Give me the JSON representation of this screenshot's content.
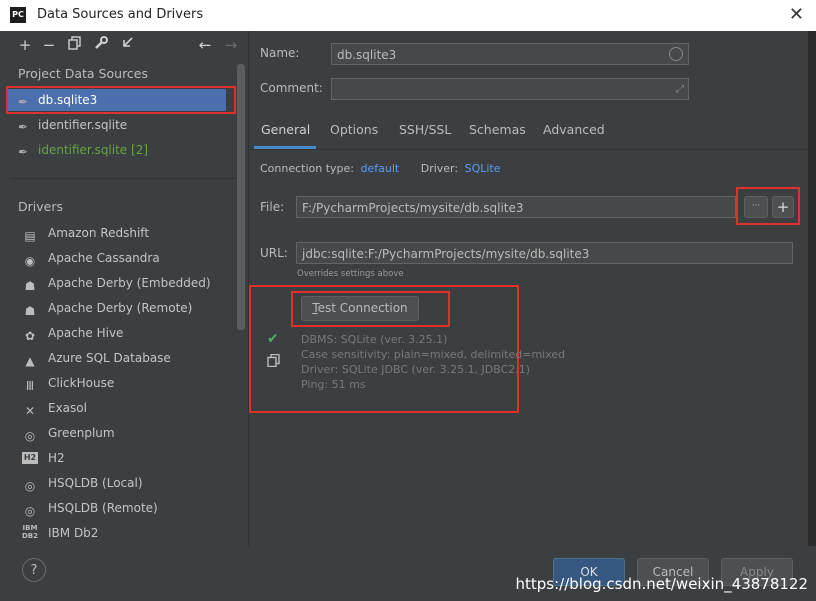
{
  "window": {
    "title": "Data Sources and Drivers",
    "app_icon": "PC"
  },
  "toolbar": {
    "items": [
      "+",
      "−",
      "copy-icon",
      "wrench-icon",
      "import-icon",
      "←",
      "→"
    ]
  },
  "left": {
    "project_header": "Project Data Sources",
    "sources": [
      {
        "label": "db.sqlite3",
        "state": "selected"
      },
      {
        "label": "identifier.sqlite",
        "state": "normal"
      },
      {
        "label": "identifier.sqlite [2]",
        "state": "green"
      }
    ],
    "drivers_header": "Drivers",
    "drivers": [
      "Amazon Redshift",
      "Apache Cassandra",
      "Apache Derby (Embedded)",
      "Apache Derby (Remote)",
      "Apache Hive",
      "Azure SQL Database",
      "ClickHouse",
      "Exasol",
      "Greenplum",
      "H2",
      "HSQLDB (Local)",
      "HSQLDB (Remote)",
      "IBM Db2"
    ]
  },
  "form": {
    "name_label": "Name:",
    "name_value": "db.sqlite3",
    "comment_label": "Comment:",
    "comment_value": ""
  },
  "tabs": [
    "General",
    "Options",
    "SSH/SSL",
    "Schemas",
    "Advanced"
  ],
  "general": {
    "conn_type_label": "Connection type:",
    "conn_type_value": "default",
    "driver_label": "Driver:",
    "driver_value": "SQLite",
    "file_label": "File:",
    "file_value": "F:/PycharmProjects/mysite/db.sqlite3",
    "browse_label": "···",
    "add_label": "+",
    "url_label": "URL:",
    "url_value": "jdbc:sqlite:F:/PycharmProjects/mysite/db.sqlite3",
    "overrides_note": "Overrides settings above",
    "test_btn_prefix": "T",
    "test_btn_rest": "est Connection",
    "result_lines": [
      "DBMS: SQLite (ver. 3.25.1)",
      "Case sensitivity: plain=mixed, delimited=mixed",
      "Driver: SQLite JDBC (ver. 3.25.1, JDBC2.1)",
      "Ping: 51 ms"
    ]
  },
  "footer": {
    "help": "?",
    "ok": "OK",
    "cancel": "Cancel",
    "apply": "Apply",
    "watermark": "https://blog.csdn.net/weixin_43878122"
  },
  "colors": {
    "accent": "#4a88c7",
    "selection": "#4b6eaf",
    "red_box": "#e0302a",
    "success": "#59a869"
  }
}
